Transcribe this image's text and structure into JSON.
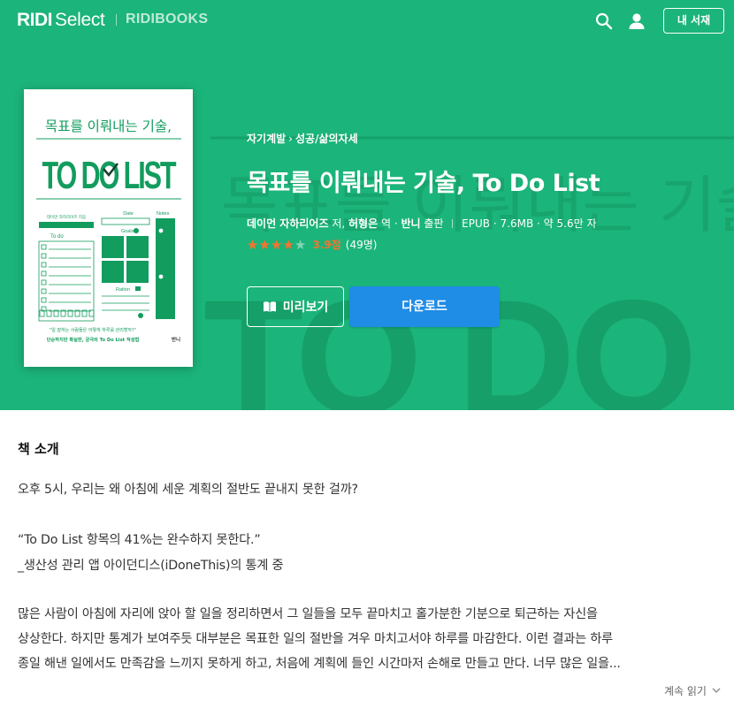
{
  "header": {
    "logo_ridi": "RIDI",
    "logo_select": "Select",
    "logo_ridibooks": "RIDIBOOKS",
    "mylib_label": "내 서재",
    "icons": [
      "search-icon",
      "user-icon"
    ]
  },
  "cover": {
    "top_title": "목표를 이뤄내는 기술,",
    "big_title": "TO DO LIST",
    "col_todo": "To do",
    "col_date": "Date",
    "col_notes": "Notes",
    "col_goals": "Goals",
    "col_ration": "Ration",
    "quote": "\"일 잘하는 사람들은 어떻게 하루를 관리할까?\"",
    "tagline": "단순하지만 확실한, 궁극의 To Do List 작성법",
    "publisher": "반니"
  },
  "book": {
    "breadcrumb": [
      "자기계발",
      "성공/삶의자세"
    ],
    "title": "목표를 이뤄내는 기술, To Do List",
    "author": "데이먼 자하리어즈",
    "author_role": "저,",
    "translator": "허형은",
    "translator_role": "역",
    "publisher": "반니",
    "publisher_role": "출판",
    "format": "EPUB",
    "size": "7.6MB",
    "length": "약 5.6만 자",
    "rating": 3.9,
    "rating_label": "3.9점",
    "rating_count": "(49명)",
    "preview_label": "미리보기",
    "download_label": "다운로드"
  },
  "intro": {
    "heading": "책 소개",
    "lines": [
      "오후 5시, 우리는 왜 아침에 세운 계획의 절반도 끝내지 못한 걸까?",
      "“To Do List 항목의 41%는 완수하지 못한다.”",
      "_생산성 관리 앱 아이던디스(iDoneThis)의 통계 중",
      "많은 사람이 아침에 자리에 앉아 할 일을 정리하면서 그 일들을 모두 끝마치고 홀가분한 기분으로 퇴근하는 자신을",
      "상상한다. 하지만 통계가 보여주듯 대부분은 목표한 일의 절반을 겨우 마치고서야 하루를 마감한다. 이런 결과는 하루",
      "종일 해낸 일에서도 만족감을 느끼지 못하게 하고, 처음에 계획에 들인 시간마저 손해로 만들고 만다. 너무 많은 일을..."
    ],
    "read_more": "계속 읽기"
  },
  "colors": {
    "brand_green": "#1bb47a",
    "button_blue": "#1f8ce6",
    "star_orange": "#fa722e",
    "cover_green": "#129c5e"
  }
}
